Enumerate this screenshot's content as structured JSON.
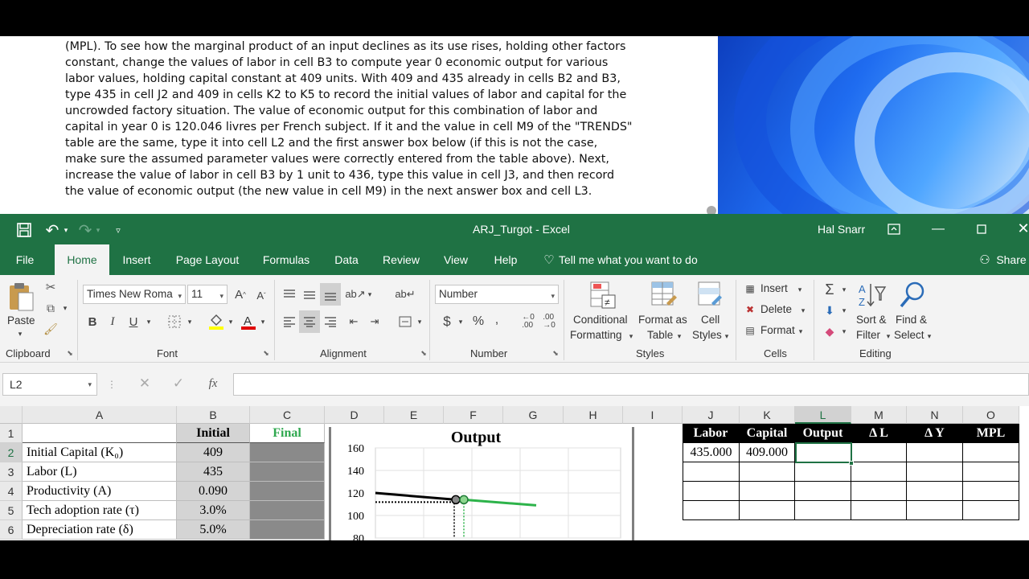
{
  "document": {
    "paragraph": "(MPL). To see how the marginal product of an input declines as its use rises, holding other factors\nconstant, change the values of labor in cell B3 to compute year 0 economic output for various\nlabor values, holding capital constant at 409 units. With 409 and 435 already in cells B2 and B3,\ntype 435 in cell J2 and 409 in cells K2 to K5 to record the initial values of labor and capital for the\nuncrowded factory situation. The value of economic output for this combination of labor and\ncapital in year 0 is 120.046 livres per French subject. If it and the value in cell M9 of the \"TRENDS\"\ntable are the same, type it into cell L2 and the first answer box below (if this is not the case,\nmake sure the assumed parameter values were correctly entered from the table above). Next,\nincrease the value of labor in cell B3 by 1 unit to 436, type this value in cell J3, and then record\nthe value of economic output (the new value in cell M9) in the next answer box and cell L3."
  },
  "excel": {
    "title": "ARJ_Turgot  -  Excel",
    "user": "Hal Snarr",
    "tabs": [
      "File",
      "Home",
      "Insert",
      "Page Layout",
      "Formulas",
      "Data",
      "Review",
      "View",
      "Help"
    ],
    "tell_me": "Tell me what you want to do",
    "share": "Share",
    "ribbon": {
      "paste": "Paste",
      "clipboard": "Clipboard",
      "font_name": "Times New Roma",
      "font_size": "11",
      "font": "Font",
      "alignment": "Alignment",
      "number_format": "Number",
      "number": "Number",
      "conditional": "Conditional",
      "formatting": "Formatting",
      "format_as": "Format as",
      "table": "Table",
      "cell": "Cell",
      "styles_btn": "Styles",
      "styles": "Styles",
      "insert": "Insert",
      "delete": "Delete",
      "format": "Format",
      "cells": "Cells",
      "sort": "Sort &",
      "filter": "Filter",
      "find": "Find &",
      "select": "Select",
      "editing": "Editing"
    },
    "name_box": "L2",
    "columns": [
      "A",
      "B",
      "C",
      "D",
      "E",
      "F",
      "G",
      "H",
      "I",
      "J",
      "K",
      "L",
      "M",
      "N",
      "O"
    ],
    "rows": [
      "1",
      "2",
      "3",
      "4",
      "5",
      "6"
    ],
    "params": {
      "header_initial": "Initial",
      "header_final": "Final",
      "labels": [
        "Initial Capital (K₀)",
        "Labor (L)",
        "Productivity (A)",
        "Tech adoption rate (τ)",
        "Depreciation rate (δ)"
      ],
      "values": [
        "409",
        "435",
        "0.090",
        "3.0%",
        "5.0%"
      ]
    },
    "chart": {
      "title": "Output",
      "y_ticks": [
        "160",
        "140",
        "120",
        "100",
        "80"
      ]
    },
    "answer_table": {
      "headers": [
        "Labor",
        "Capital",
        "Output",
        "Δ L",
        "Δ Y",
        "MPL"
      ],
      "row1": [
        "435.000",
        "409.000",
        "",
        "",
        "",
        ""
      ]
    }
  },
  "chart_data": {
    "type": "line",
    "title": "Output",
    "ylim": [
      80,
      160
    ],
    "y_ticks": [
      160,
      140,
      120,
      100,
      80
    ],
    "series": [
      {
        "color": "#000000",
        "x": [
          0,
          1
        ],
        "y": [
          120,
          114
        ]
      },
      {
        "color": "#2db34a",
        "x": [
          1,
          2
        ],
        "y": [
          114,
          109
        ]
      }
    ]
  }
}
